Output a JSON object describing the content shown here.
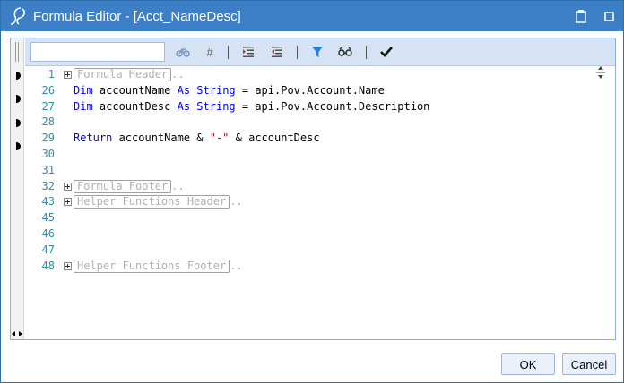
{
  "window": {
    "title": "Formula Editor - [Acct_NameDesc]",
    "accent_color": "#3c7fc6",
    "icons": [
      "app-logo-icon",
      "maximize-icon",
      "restore-icon"
    ]
  },
  "toolbar": {
    "search_placeholder": "",
    "hash_label": "#",
    "icons": [
      "bike-icon",
      "hash-icon",
      "indent-icon",
      "outdent-icon",
      "filter-icon",
      "glasses-icon",
      "checkmark-icon"
    ]
  },
  "editor": {
    "lines": [
      {
        "num": "1",
        "collapsed": "Formula Header",
        "ellipsis": ".."
      },
      {
        "num": "26",
        "tokens": [
          {
            "t": "Dim",
            "c": "kw"
          },
          {
            "t": " accountName ",
            "c": ""
          },
          {
            "t": "As",
            "c": "kw"
          },
          {
            "t": " ",
            "c": ""
          },
          {
            "t": "String",
            "c": "kw"
          },
          {
            "t": " = api.Pov.Account.Name",
            "c": ""
          }
        ]
      },
      {
        "num": "27",
        "tokens": [
          {
            "t": "Dim",
            "c": "kw"
          },
          {
            "t": " accountDesc ",
            "c": ""
          },
          {
            "t": "As",
            "c": "kw"
          },
          {
            "t": " ",
            "c": ""
          },
          {
            "t": "String",
            "c": "kw"
          },
          {
            "t": " = api.Pov.Account.Description",
            "c": ""
          }
        ]
      },
      {
        "num": "28",
        "tokens": []
      },
      {
        "num": "29",
        "tokens": [
          {
            "t": "Return",
            "c": "kw"
          },
          {
            "t": " accountName & ",
            "c": ""
          },
          {
            "t": "\"-\"",
            "c": "str"
          },
          {
            "t": " & accountDesc",
            "c": ""
          }
        ]
      },
      {
        "num": "30",
        "tokens": []
      },
      {
        "num": "31",
        "tokens": []
      },
      {
        "num": "32",
        "collapsed": "Formula Footer",
        "ellipsis": ".."
      },
      {
        "num": "43",
        "collapsed": "Helper Functions Header",
        "ellipsis": ".."
      },
      {
        "num": "45",
        "tokens": []
      },
      {
        "num": "46",
        "tokens": []
      },
      {
        "num": "47",
        "tokens": []
      },
      {
        "num": "48",
        "collapsed": "Helper Functions Footer",
        "ellipsis": ".."
      }
    ]
  },
  "buttons": {
    "ok_label": "OK",
    "cancel_label": "Cancel"
  }
}
